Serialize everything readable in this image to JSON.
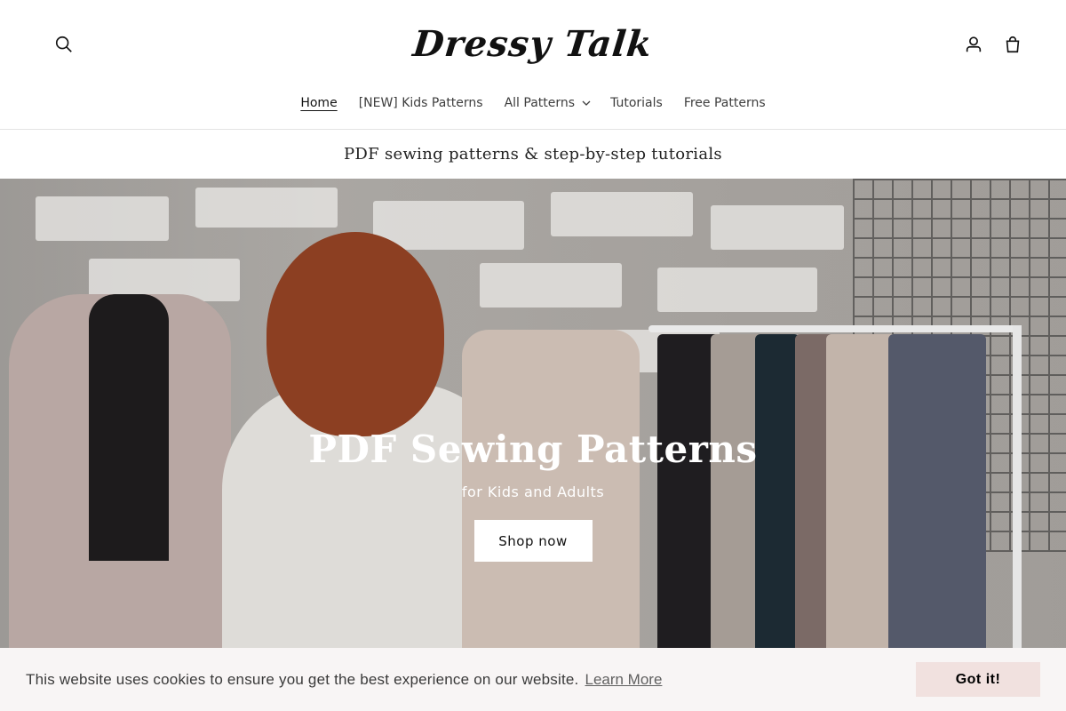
{
  "header": {
    "logo_text": "Dressy Talk",
    "icons": {
      "search": "search-icon",
      "account": "user-icon",
      "cart": "cart-icon"
    }
  },
  "nav": {
    "items": [
      {
        "label": "Home",
        "active": true
      },
      {
        "label": "[NEW] Kids Patterns",
        "active": false
      },
      {
        "label": "All Patterns",
        "active": false,
        "dropdown": true
      },
      {
        "label": "Tutorials",
        "active": false
      },
      {
        "label": "Free Patterns",
        "active": false
      }
    ]
  },
  "announcement": {
    "text": "PDF sewing patterns & step-by-step tutorials"
  },
  "hero": {
    "title": "PDF Sewing Patterns",
    "subtitle": "for Kids and Adults",
    "button_label": "Shop now"
  },
  "cookie": {
    "message": "This website uses cookies to ensure you get the best experience on our website.",
    "link_label": "Learn More",
    "accept_label": "Got it!",
    "accept_color": "#f1e1df"
  }
}
